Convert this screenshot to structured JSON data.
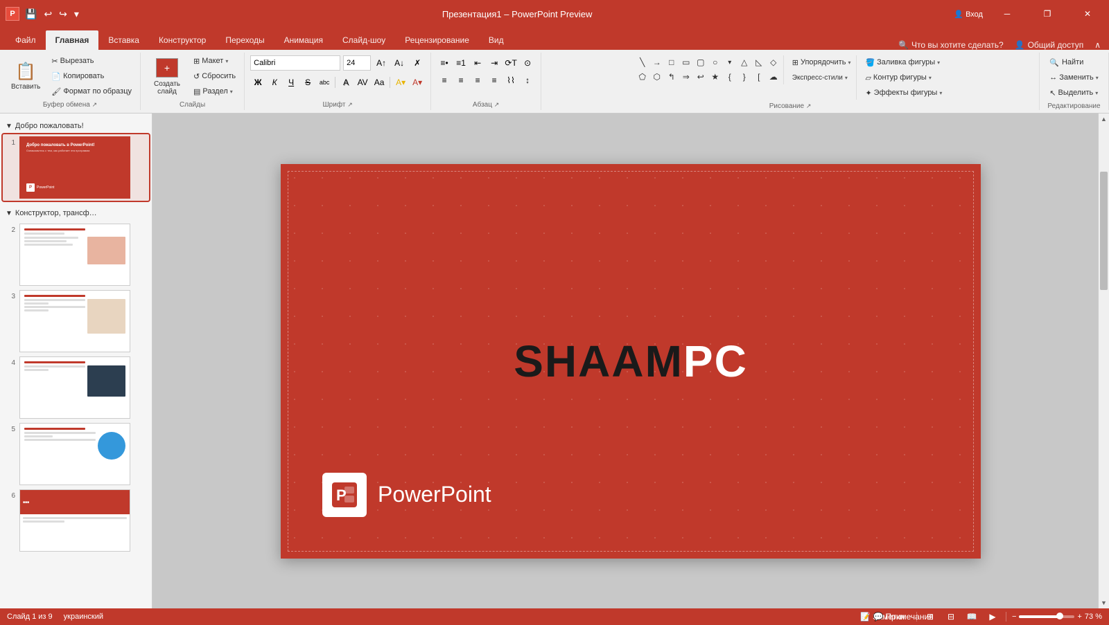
{
  "titleBar": {
    "appName": "Презентация1",
    "separator": "–",
    "product": "PowerPoint Preview",
    "signIn": "Вход",
    "icons": {
      "save": "💾",
      "undo": "↩",
      "redo": "↪",
      "customize": "▾"
    },
    "windowControls": {
      "minimize": "─",
      "maximize": "□",
      "restore": "❐",
      "close": "✕"
    }
  },
  "ribbonTabs": {
    "tabs": [
      {
        "label": "Файл",
        "active": false
      },
      {
        "label": "Главная",
        "active": true
      },
      {
        "label": "Вставка",
        "active": false
      },
      {
        "label": "Конструктор",
        "active": false
      },
      {
        "label": "Переходы",
        "active": false
      },
      {
        "label": "Анимация",
        "active": false
      },
      {
        "label": "Слайд-шоу",
        "active": false
      },
      {
        "label": "Рецензирование",
        "active": false
      },
      {
        "label": "Вид",
        "active": false
      }
    ],
    "search": "Что вы хотите сделать?",
    "shareBtn": "Общий доступ"
  },
  "ribbon": {
    "groups": [
      {
        "name": "clipboard",
        "label": "Буфер обмена",
        "buttons": [
          {
            "id": "paste",
            "label": "Вставить",
            "icon": "📋"
          },
          {
            "id": "cut",
            "label": "Вырезать",
            "icon": "✂"
          },
          {
            "id": "copy",
            "label": "Копировать",
            "icon": "📄"
          },
          {
            "id": "format-painter",
            "label": "Формат",
            "icon": "🖌"
          }
        ]
      },
      {
        "name": "slides",
        "label": "Слайды",
        "buttons": [
          {
            "id": "new-slide",
            "label": "Создать слайд",
            "icon": "➕"
          },
          {
            "id": "layout",
            "label": "Макет ▾"
          },
          {
            "id": "reset",
            "label": "Сбросить"
          },
          {
            "id": "section",
            "label": "Раздел ▾"
          }
        ]
      },
      {
        "name": "font",
        "label": "Шрифт",
        "fontName": "Calibri",
        "fontSize": "24",
        "boldLabel": "Ж",
        "italicLabel": "К",
        "underlineLabel": "Ч",
        "strikeLabel": "S",
        "subscriptLabel": "abc",
        "shadowLabel": "A",
        "colorLabel": "A"
      },
      {
        "name": "paragraph",
        "label": "Абзац"
      },
      {
        "name": "drawing",
        "label": "Рисование"
      },
      {
        "name": "editing",
        "label": "Редактирование",
        "buttons": [
          {
            "id": "find",
            "label": "Найти",
            "icon": "🔍"
          },
          {
            "id": "replace",
            "label": "Заменить ▾"
          },
          {
            "id": "select",
            "label": "Выделить ▾"
          }
        ]
      }
    ]
  },
  "slidePanel": {
    "sections": [
      {
        "id": "section1",
        "title": "Добро пожаловать!",
        "slides": [
          {
            "num": 1,
            "active": true
          }
        ]
      },
      {
        "id": "section2",
        "title": "Конструктор, трансф…",
        "slides": [
          {
            "num": 2,
            "active": false
          },
          {
            "num": 3,
            "active": false
          },
          {
            "num": 4,
            "active": false
          },
          {
            "num": 5,
            "active": false
          },
          {
            "num": 6,
            "active": false
          }
        ]
      }
    ]
  },
  "mainSlide": {
    "logoText": "SHAAM",
    "logoAccent": "PC",
    "brandName": "PowerPoint"
  },
  "statusBar": {
    "slideInfo": "Слайд 1 из 9",
    "language": "украинский",
    "notesLabel": "Заметки",
    "commentsLabel": "Примечания",
    "zoom": "73 %",
    "zoomValue": 73
  }
}
